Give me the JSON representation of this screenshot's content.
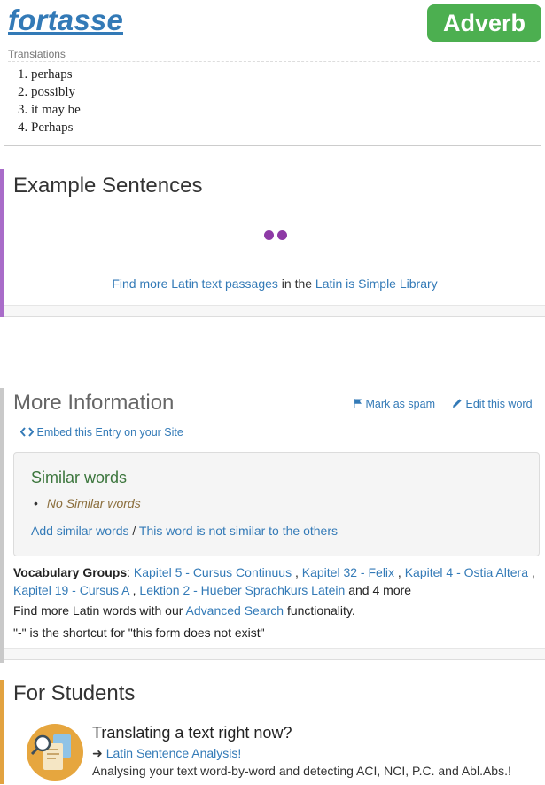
{
  "header": {
    "word": "fortasse",
    "part_of_speech": "Adverb",
    "translations_label": "Translations",
    "translations": [
      "perhaps",
      "possibly",
      "it may be",
      "Perhaps"
    ]
  },
  "examples": {
    "title": "Example Sentences",
    "find_more_link": "Find more Latin text passages",
    "find_more_middle": " in the ",
    "library_link": "Latin is Simple Library"
  },
  "more_info": {
    "title": "More Information",
    "mark_spam": "Mark as spam",
    "edit_word": "Edit this word",
    "embed": "Embed this Entry on your Site",
    "similar": {
      "title": "Similar words",
      "items": [
        "No Similar words"
      ],
      "add_link": "Add similar words",
      "separator": " / ",
      "not_similar_link": "This word is not similar to the others"
    },
    "vocab_label": "Vocabulary Groups",
    "vocab_groups": [
      "Kapitel 5 - Cursus Continuus",
      "Kapitel 32 - Felix",
      "Kapitel 4 - Ostia Altera",
      "Kapitel 19 - Cursus A",
      "Lektion 2 - Hueber Sprachkurs Latein"
    ],
    "vocab_more": "and 4 more",
    "advanced_prefix": "Find more Latin words with our ",
    "advanced_link": "Advanced Search",
    "advanced_suffix": " functionality.",
    "shortcut_note": "\"-\" is the shortcut for \"this form does not exist\""
  },
  "students": {
    "title": "For Students",
    "heading": "Translating a text right now?",
    "link": "Latin Sentence Analysis!",
    "description": "Analysing your text word-by-word and detecting ACI, NCI, P.C. and Abl.Abs.!"
  },
  "colors": {
    "link": "#337ab7",
    "badge": "#4caf50",
    "examples_accent": "#a96cc9",
    "students_accent": "#e2a240",
    "similar_title": "#3c763d"
  }
}
